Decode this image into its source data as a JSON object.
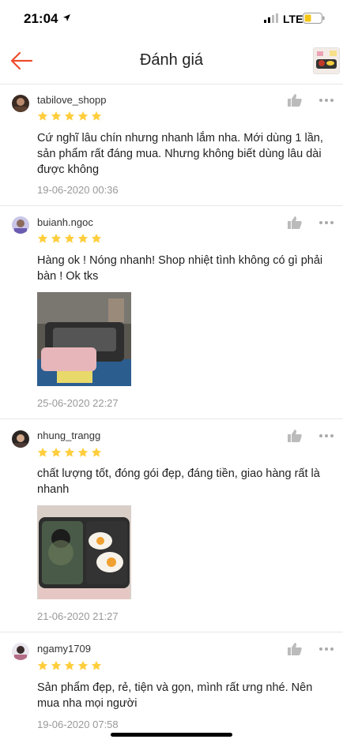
{
  "status_bar": {
    "time": "21:04",
    "network": "LTE",
    "icons": [
      "location-arrow-icon",
      "signal-icon",
      "battery-icon"
    ]
  },
  "header": {
    "title": "Đánh giá",
    "back_icon": "arrow-left-icon"
  },
  "colors": {
    "accent": "#ee4d2d",
    "star": "#ffce3d",
    "muted": "#999999"
  },
  "reviews": [
    {
      "username": "tabilove_shopp",
      "rating": 5,
      "comment": "Cứ nghĩ lâu chín nhưng nhanh lắm nha. Mới dùng 1 lần, sản phẩm rất đáng mua. Nhưng không biết dùng lâu dài được không",
      "date": "19-06-2020 00:36"
    },
    {
      "username": "buianh.ngoc",
      "rating": 5,
      "comment": "Hàng ok ! Nóng nhanh! Shop nhiệt tình không có gì phải bàn ! Ok tks",
      "date": "25-06-2020 22:27"
    },
    {
      "username": "nhung_trangg",
      "rating": 5,
      "comment": "chất lượng tốt, đóng gói đẹp, đáng tiền, giao hàng rất là nhanh",
      "date": "21-06-2020 21:27"
    },
    {
      "username": "ngamy1709",
      "rating": 5,
      "comment": "Sản phẩm đẹp, rẻ, tiện và gọn, mình rất ưng nhé. Nên mua nha mọi người",
      "date": "19-06-2020 07:58"
    }
  ]
}
